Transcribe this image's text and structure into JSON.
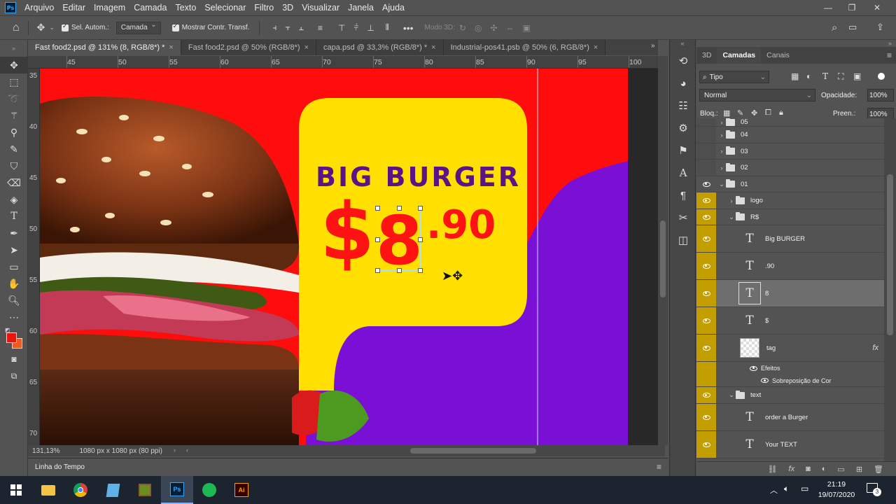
{
  "menubar": {
    "app_icon": "ps-logo",
    "items": [
      "Arquivo",
      "Editar",
      "Imagem",
      "Camada",
      "Texto",
      "Selecionar",
      "Filtro",
      "3D",
      "Visualizar",
      "Janela",
      "Ajuda"
    ]
  },
  "options": {
    "auto_select_label": "Sel. Autom.:",
    "auto_select_value": "Camada",
    "show_transform_label": "Mostrar Contr. Transf.",
    "mode3d_label": "Modo 3D:"
  },
  "tabs": [
    {
      "label": "Fast food2.psd @ 131% (8, RGB/8*) *",
      "active": true
    },
    {
      "label": "Fast food2.psd @ 50% (RGB/8*)",
      "active": false
    },
    {
      "label": "capa.psd @ 33,3% (RGB/8*) *",
      "active": false
    },
    {
      "label": "Industrial-pos41.psb @ 50% (6, RGB/8*)",
      "active": false
    }
  ],
  "ruler": {
    "top": [
      "45",
      "50",
      "55",
      "60",
      "65",
      "70",
      "75",
      "80",
      "85",
      "90",
      "95",
      "100"
    ],
    "left": [
      "35",
      "40",
      "45",
      "50",
      "55",
      "60",
      "65",
      "70"
    ]
  },
  "artwork": {
    "headline": "BIG BURGER",
    "currency": "$",
    "price_main": "8",
    "price_cents": ".90",
    "colors": {
      "red": "#ff0d0d",
      "yellow": "#ffe000",
      "purple": "#7a10d6",
      "headline": "#5b1485"
    }
  },
  "status": {
    "zoom": "131,13%",
    "doc_info": "1080 px x 1080 px (80 ppi)"
  },
  "timeline_label": "Linha do Tempo",
  "panel": {
    "tabs": [
      "3D",
      "Camadas",
      "Canais"
    ],
    "filter_value": "Tipo",
    "blend_mode": "Normal",
    "opacity_label": "Opacidade:",
    "opacity_value": "100%",
    "lock_label": "Bloq.:",
    "fill_label": "Preen.:",
    "fill_value": "100%"
  },
  "layers": [
    {
      "name": "05",
      "kind": "group",
      "visible": false
    },
    {
      "name": "04",
      "kind": "group",
      "visible": false
    },
    {
      "name": "03",
      "kind": "group",
      "visible": false
    },
    {
      "name": "02",
      "kind": "group",
      "visible": false
    },
    {
      "name": "01",
      "kind": "group",
      "visible": true
    },
    {
      "name": "logo",
      "kind": "group",
      "visible": true
    },
    {
      "name": "R$",
      "kind": "group",
      "visible": true
    },
    {
      "name": "Big BURGER",
      "kind": "text",
      "visible": true
    },
    {
      "name": ".90",
      "kind": "text",
      "visible": true
    },
    {
      "name": "8",
      "kind": "text",
      "visible": true,
      "selected": true
    },
    {
      "name": "$",
      "kind": "text",
      "visible": true
    },
    {
      "name": "tag",
      "kind": "image",
      "visible": true,
      "fx": "fx"
    },
    {
      "name": "Efeitos",
      "kind": "effects",
      "visible": true
    },
    {
      "name": "Sobreposição de Cor",
      "kind": "effect",
      "visible": true
    },
    {
      "name": "text",
      "kind": "group",
      "visible": true
    },
    {
      "name": "order a Burger",
      "kind": "text",
      "visible": true
    },
    {
      "name": "Your TEXT",
      "kind": "text",
      "visible": true
    }
  ],
  "taskbar": {
    "time": "21:19",
    "date": "19/07/2020",
    "notifications": "3",
    "apps": [
      "windows-start",
      "file-explorer",
      "chrome",
      "notepad",
      "minecraft",
      "photoshop",
      "spotify",
      "illustrator"
    ]
  }
}
